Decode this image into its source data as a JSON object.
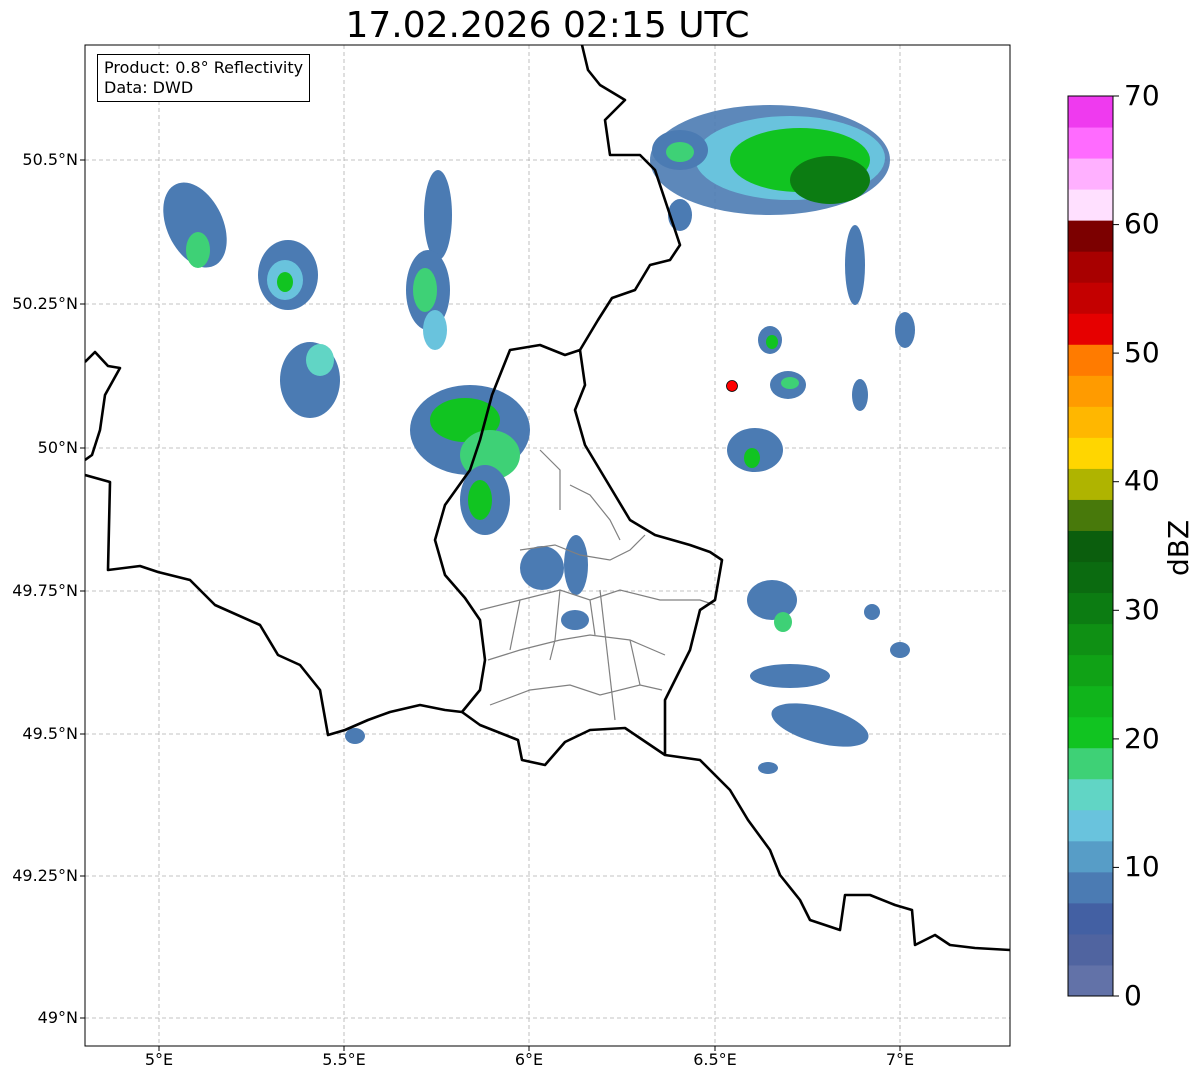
{
  "title": "17.02.2026 02:15 UTC",
  "info": {
    "product": "Product: 0.8° Reflectivity",
    "data": "Data: DWD"
  },
  "lat_labels": [
    "50.5°N",
    "50.25°N",
    "50°N",
    "49.75°N",
    "49.5°N",
    "49.25°N",
    "49°N"
  ],
  "lon_labels": [
    "5°E",
    "5.5°E",
    "6°E",
    "6.5°E",
    "7°E"
  ],
  "colorbar": {
    "unit": "dBZ",
    "tick_labels": [
      "0",
      "10",
      "20",
      "30",
      "40",
      "50",
      "60",
      "70"
    ],
    "colors": [
      "#6272a8",
      "#5064a0",
      "#4360a3",
      "#4b7bb3",
      "#579dc7",
      "#69c3dd",
      "#61d5c5",
      "#3ed176",
      "#11c421",
      "#10b41b",
      "#10a216",
      "#0f9014",
      "#0c7c12",
      "#0b6b10",
      "#0b5e0d",
      "#48790b",
      "#afb400",
      "#ffd600",
      "#ffb700",
      "#ff9b00",
      "#ff7b00",
      "#e60000",
      "#c40000",
      "#a80000",
      "#7c0000",
      "#ffe0ff",
      "#ffb0ff",
      "#ff6bff",
      "#ef3aef"
    ]
  },
  "colors": {
    "border": "#000000",
    "district": "#808080",
    "grid": "#b0b0b0",
    "radar_site": "#ff0000"
  },
  "radar_site_label": "radar-site"
}
